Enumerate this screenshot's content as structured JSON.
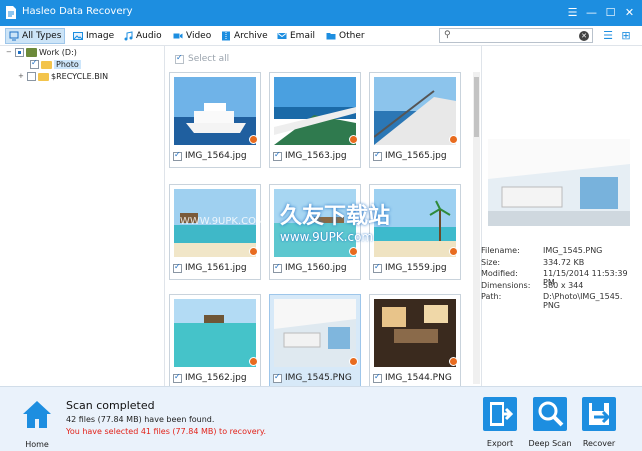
{
  "app": {
    "title": "Hasleo Data Recovery"
  },
  "window_controls": {
    "menu": "☰",
    "minimize": "—",
    "maximize": "☐",
    "close": "✕"
  },
  "type_tabs": [
    {
      "label": "All Types",
      "icon": "monitor-icon",
      "active": true
    },
    {
      "label": "Image",
      "icon": "image-icon"
    },
    {
      "label": "Audio",
      "icon": "music-note-icon"
    },
    {
      "label": "Video",
      "icon": "video-camera-icon"
    },
    {
      "label": "Archive",
      "icon": "archive-icon"
    },
    {
      "label": "Email",
      "icon": "envelope-icon"
    },
    {
      "label": "Other",
      "icon": "folder-icon"
    }
  ],
  "search": {
    "placeholder": ""
  },
  "tree": {
    "root": "Work (D:)",
    "children": [
      "Photo",
      "$RECYCLE.BIN"
    ]
  },
  "grid": {
    "select_all": "Select all",
    "files": [
      {
        "name": "IMG_1564.jpg"
      },
      {
        "name": "IMG_1563.jpg"
      },
      {
        "name": "IMG_1565.jpg"
      },
      {
        "name": "IMG_1561.jpg"
      },
      {
        "name": "IMG_1560.jpg"
      },
      {
        "name": "IMG_1559.jpg"
      },
      {
        "name": "IMG_1562.jpg"
      },
      {
        "name": "IMG_1545.PNG"
      },
      {
        "name": "IMG_1544.PNG"
      }
    ]
  },
  "watermark": {
    "text1": "久友下载站",
    "text2": "www.9UPK.com",
    "text3": "WWW.9UPK.COM"
  },
  "details": {
    "filename_label": "Filename:",
    "filename": "IMG_1545.PNG",
    "size_label": "Size:",
    "size": "334.72 KB",
    "modified_label": "Modified:",
    "modified": "11/15/2014 11:53:39 PM",
    "dimensions_label": "Dimensions:",
    "dimensions": "580 x 344",
    "path_label": "Path:",
    "path": "D:\\Photo\\IMG_1545.PNG"
  },
  "footer": {
    "home_label": "Home",
    "scan_status": "Scan completed",
    "found": "42 files (77.84 MB) have been found.",
    "selected": "You have selected 41 files (77.84 MB) to recovery.",
    "export_label": "Export",
    "deepscan_label": "Deep Scan",
    "recover_label": "Recover"
  },
  "colors": {
    "accent": "#1d8ee0",
    "warning": "#e2231a",
    "badge": "#e86b1e"
  }
}
